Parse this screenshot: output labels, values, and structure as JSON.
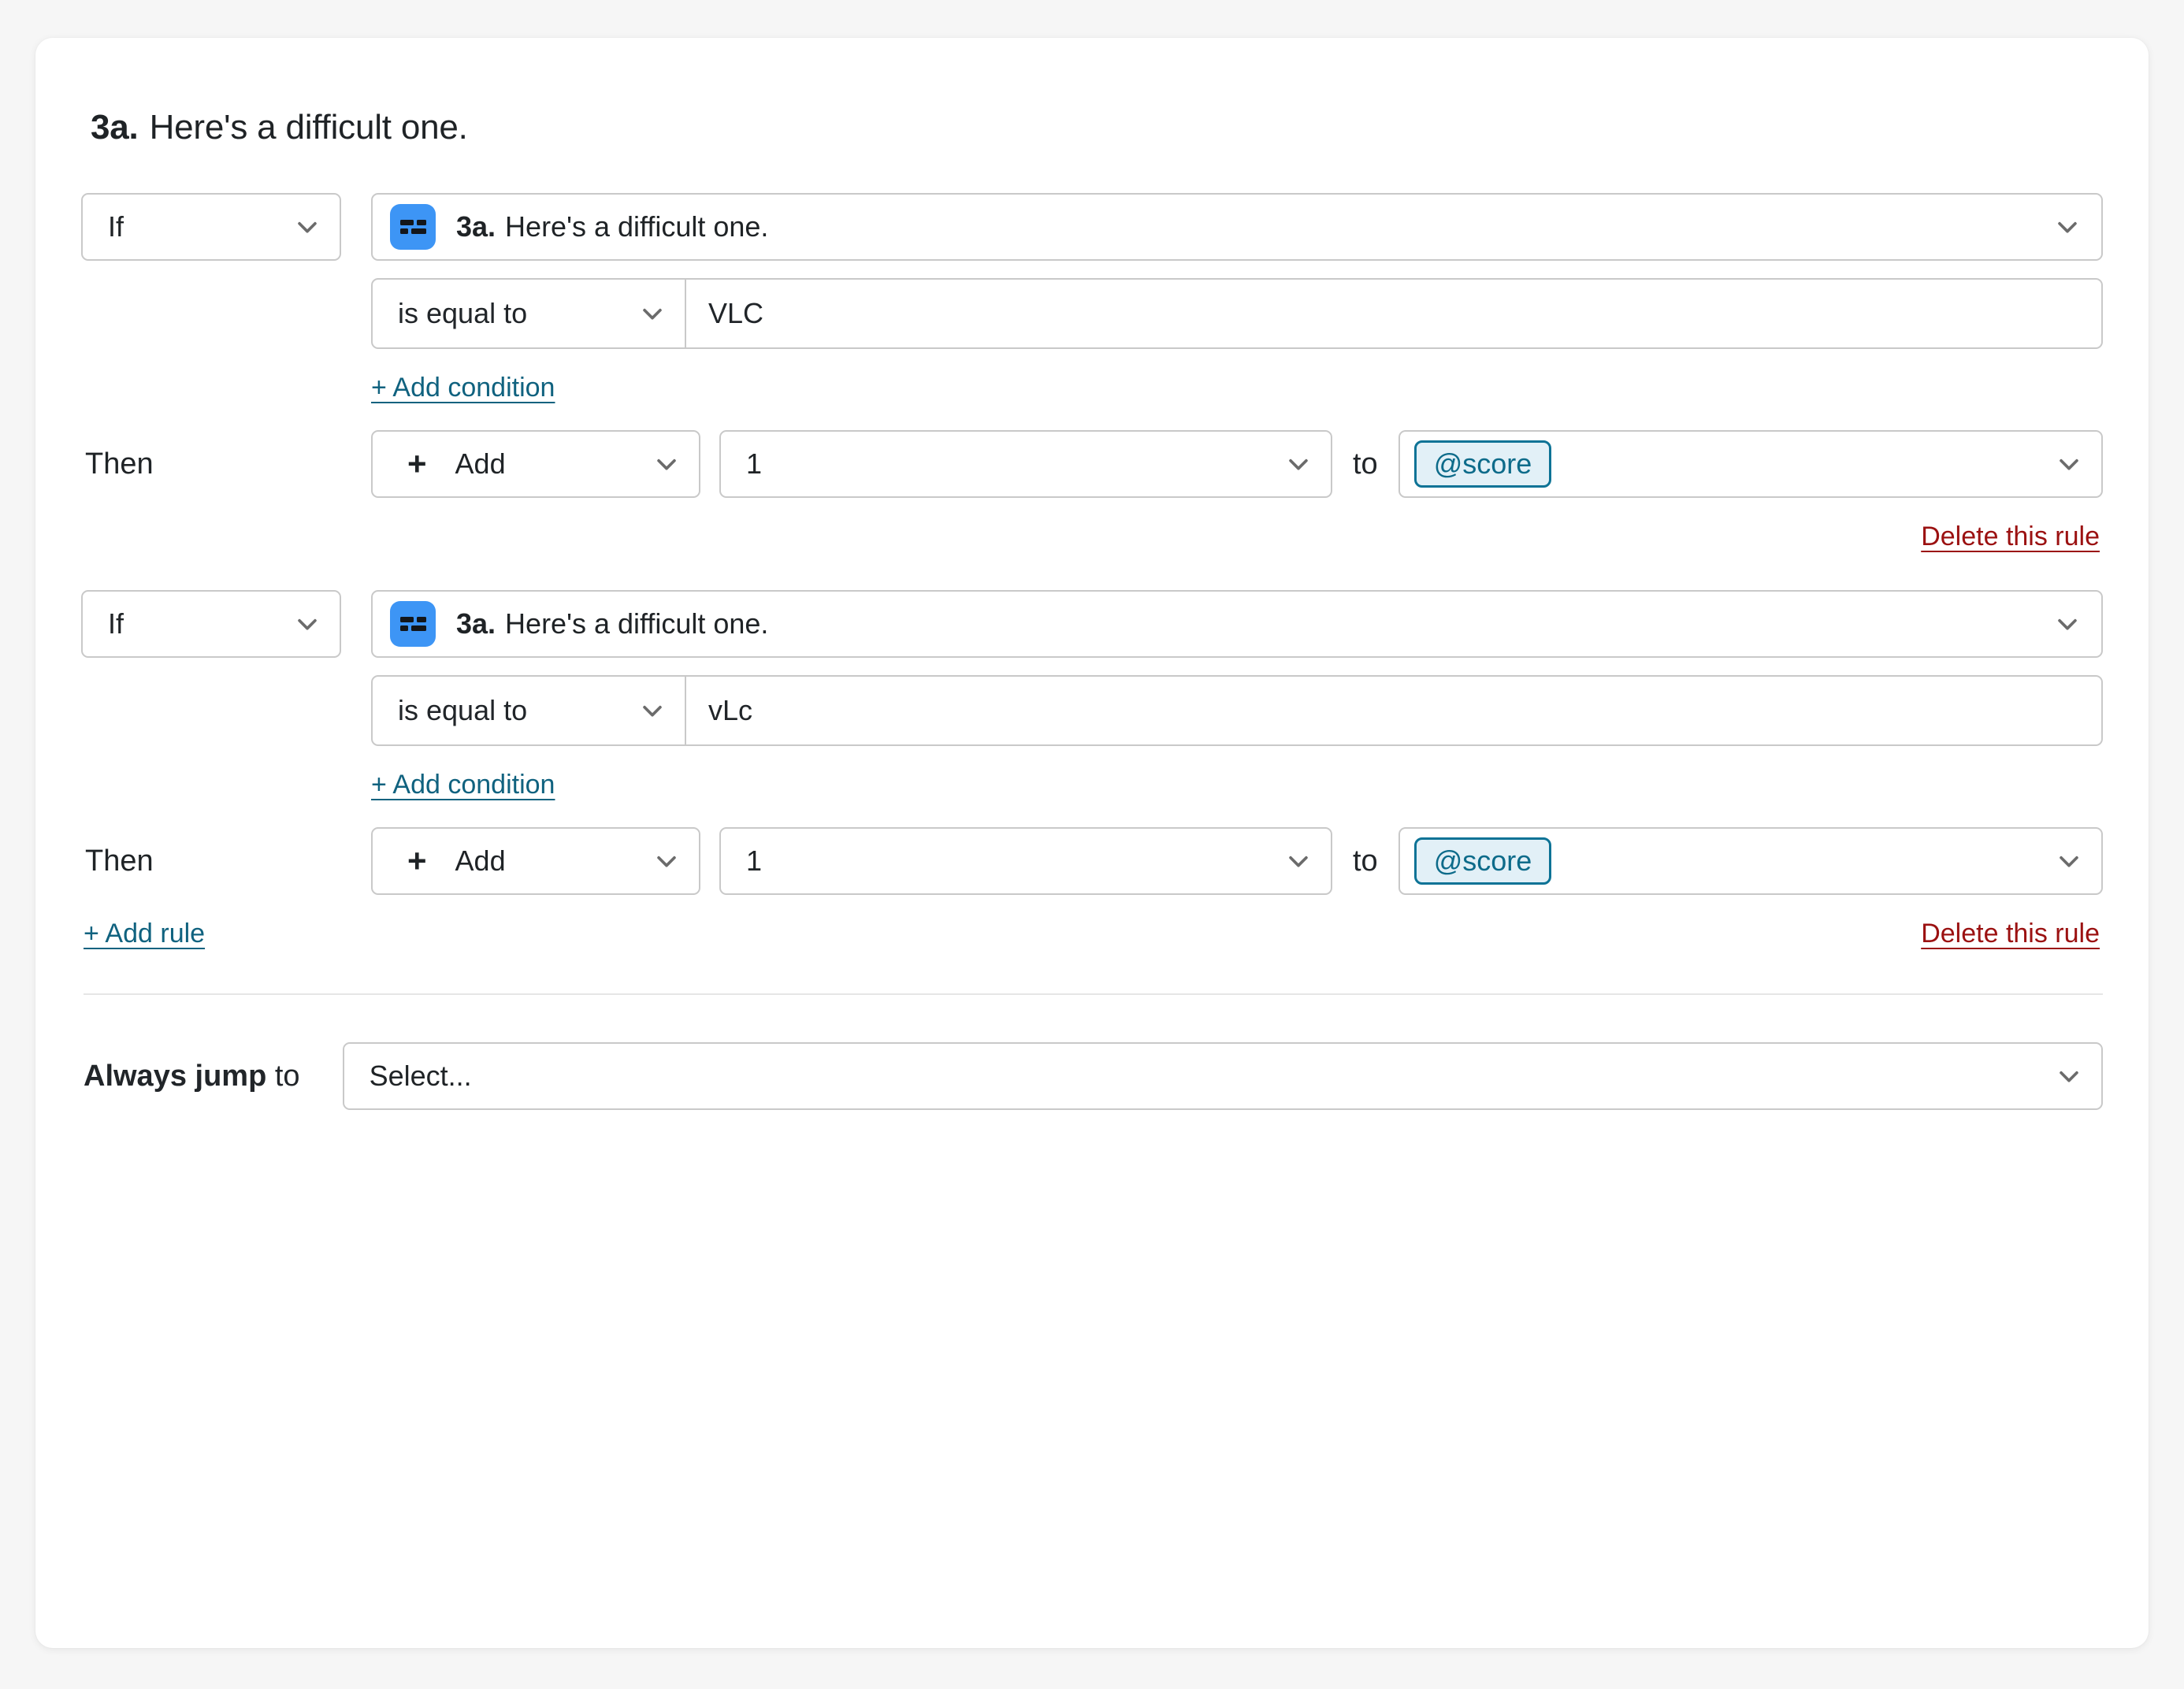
{
  "card": {
    "title": {
      "number": "3a.",
      "text": "Here's a difficult one."
    }
  },
  "rules": [
    {
      "if_label": "If",
      "question": {
        "icon": "multiple-choice-icon",
        "number": "3a.",
        "text": "Here's a difficult one."
      },
      "condition": {
        "operator": "is equal to",
        "value": "VLC"
      },
      "add_condition_label": "+ Add condition",
      "then_label": "Then",
      "action": {
        "operation": "Add",
        "plus": "+",
        "amount": "1",
        "to_label": "to",
        "variable": "@score"
      },
      "delete_label": "Delete this rule"
    },
    {
      "if_label": "If",
      "question": {
        "icon": "multiple-choice-icon",
        "number": "3a.",
        "text": "Here's a difficult one."
      },
      "condition": {
        "operator": "is equal to",
        "value": "vLc"
      },
      "add_condition_label": "+ Add condition",
      "then_label": "Then",
      "action": {
        "operation": "Add",
        "plus": "+",
        "amount": "1",
        "to_label": "to",
        "variable": "@score"
      },
      "delete_label": "Delete this rule"
    }
  ],
  "footer": {
    "add_rule_label": "+ Add rule",
    "jump": {
      "label_bold": "Always jump",
      "label_rest": "to",
      "placeholder": "Select..."
    }
  },
  "colors": {
    "accent_blue": "#3d95f5",
    "link_teal": "#10627f",
    "link_danger": "#9b1111",
    "token_border": "#0d7396",
    "token_bg": "#e2f0f7",
    "card_bg": "#ffffff",
    "page_bg": "#f6f6f6",
    "border_gray": "#c9c9c9"
  }
}
